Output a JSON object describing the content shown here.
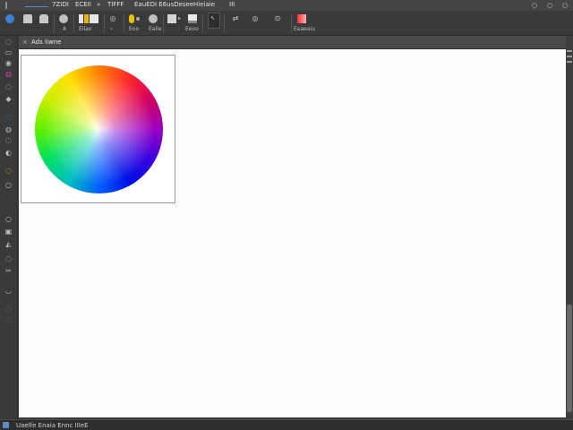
{
  "menubar": {
    "items": [
      "7ZIDI",
      "ECEII",
      "»",
      "TIFFF",
      "EauEDI E6usDesee",
      "Hieiaie",
      "III"
    ],
    "window_buttons": [
      "○",
      "○",
      "○"
    ]
  },
  "toolbar": {
    "labels": {
      "l1": "A",
      "l2": "Ellao",
      "l3": "Eoo",
      "l4": "Ealie",
      "l5": "Eeoo",
      "l6": "Eaaeaiu"
    },
    "glyphs": {
      "g_sync": "⇄",
      "g_eye": "◎",
      "g_more": "⊙"
    }
  },
  "toolbox": {
    "glyphs": [
      "◌",
      "▭",
      "◉",
      "◍",
      "◌",
      "◆",
      "◌",
      "◍",
      "◌",
      "◐",
      "◌",
      "○",
      "▣",
      "◭",
      "◌",
      "✂",
      "◡",
      "◌",
      "◌"
    ]
  },
  "document": {
    "tab_title": "Ads Iiwne",
    "tab_close": "×"
  },
  "status": {
    "text": "Uaelfe Enaia Ennc IIIeE"
  },
  "colors": {
    "accent": "#4a8fd6",
    "canvas_bg": "#fbfbfb",
    "ui_bg": "#3c3c3c"
  }
}
